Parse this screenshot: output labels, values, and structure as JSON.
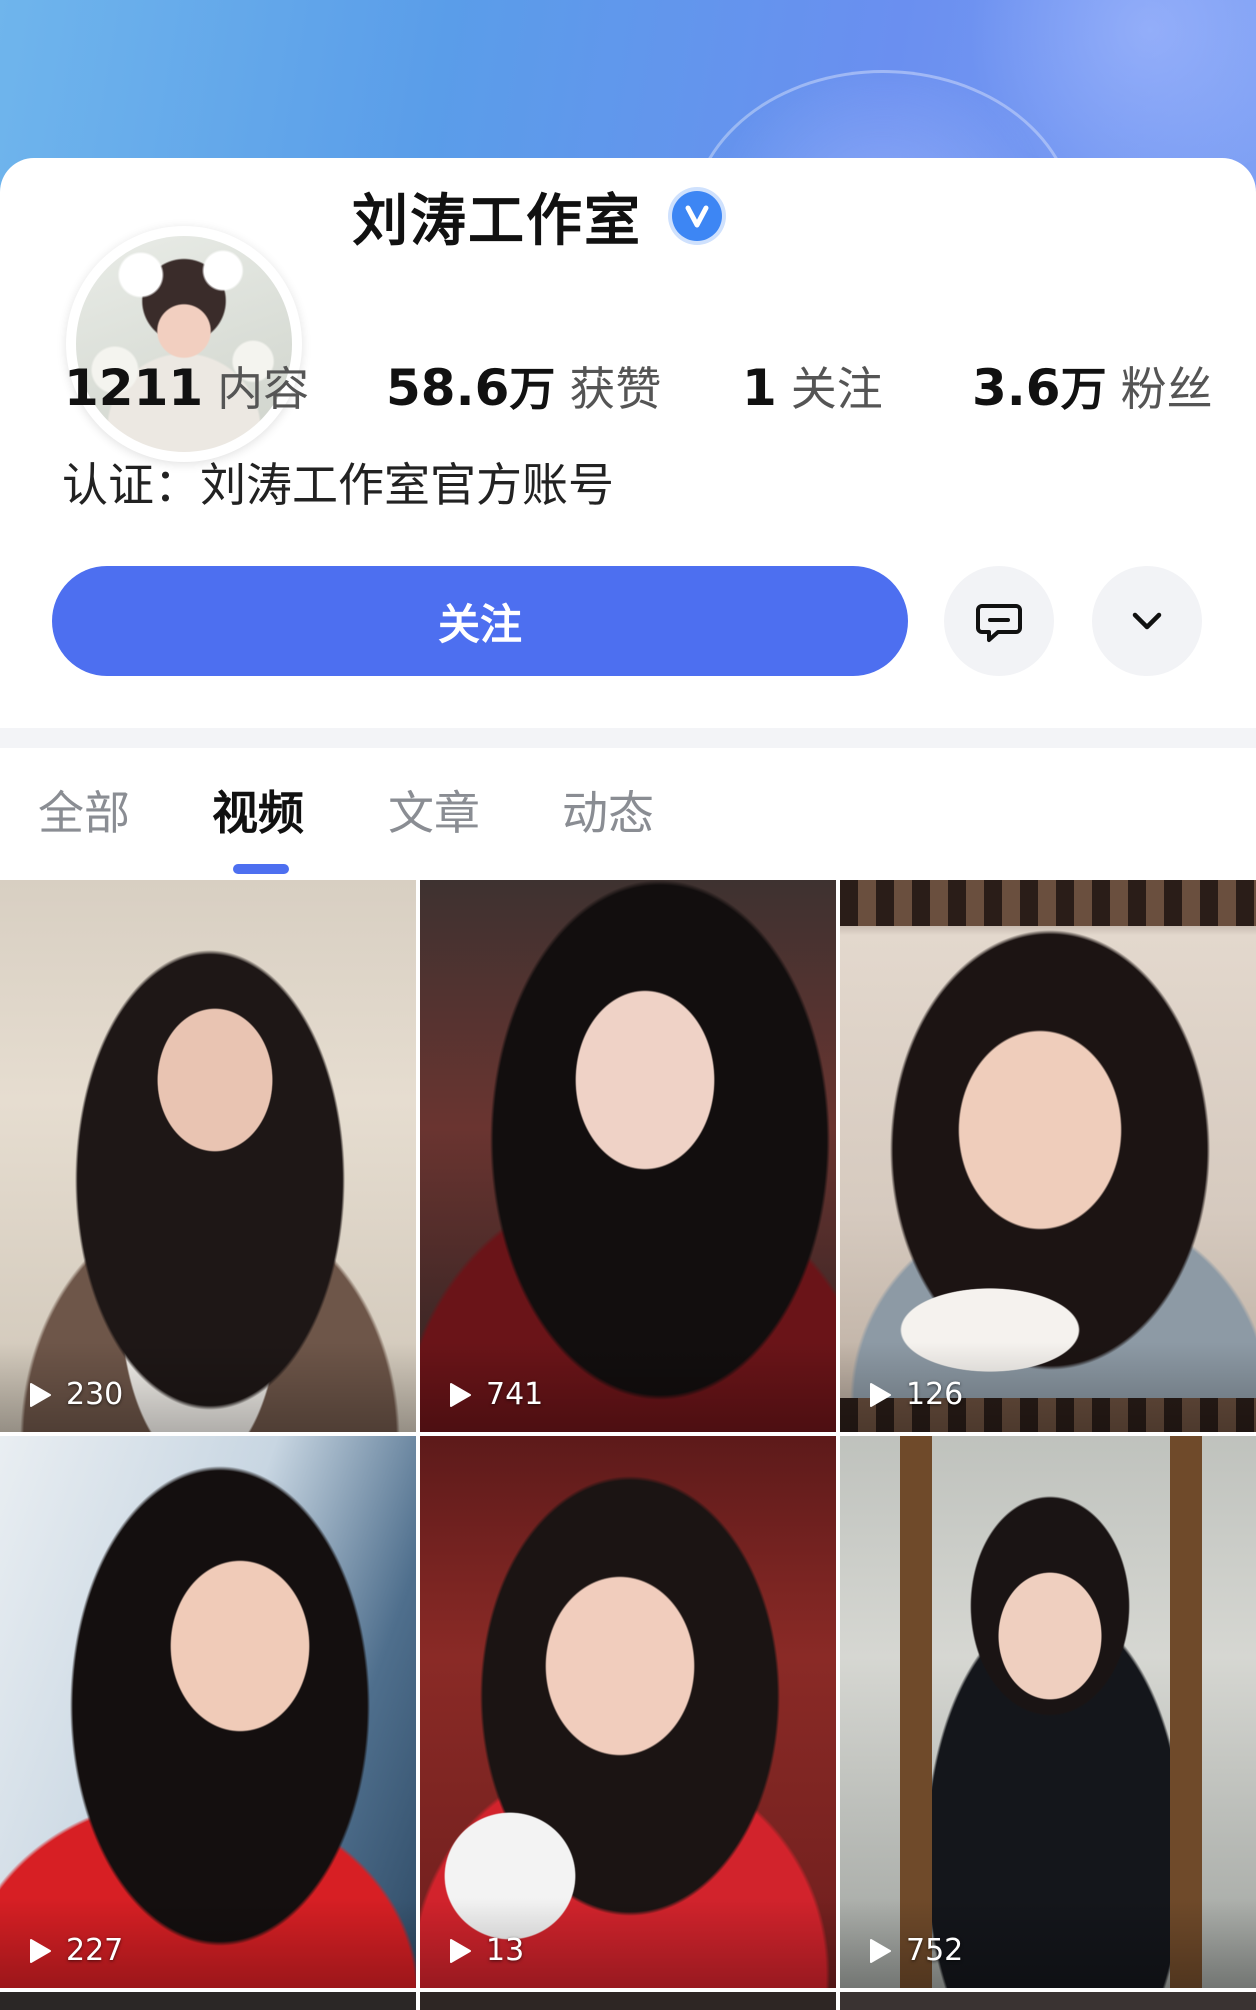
{
  "profile": {
    "name": "刘涛工作室",
    "verified_icon": "verified-v-icon",
    "stats": [
      {
        "value": "1211",
        "unit": "",
        "label": "内容"
      },
      {
        "value": "58.6",
        "unit": "万",
        "label": "获赞"
      },
      {
        "value": "1",
        "unit": "",
        "label": "关注"
      },
      {
        "value": "3.6",
        "unit": "万",
        "label": "粉丝"
      }
    ],
    "certification": "认证：刘涛工作室官方账号"
  },
  "actions": {
    "follow_label": "关注",
    "message_icon": "message-icon",
    "more_icon": "chevron-down-icon"
  },
  "tabs": [
    {
      "label": "全部",
      "active": false
    },
    {
      "label": "视频",
      "active": true
    },
    {
      "label": "文章",
      "active": false
    },
    {
      "label": "动态",
      "active": false
    }
  ],
  "videos": [
    {
      "play_count": "230"
    },
    {
      "play_count": "741"
    },
    {
      "play_count": "126"
    },
    {
      "play_count": "227"
    },
    {
      "play_count": "13"
    },
    {
      "play_count": "752"
    }
  ],
  "colors": {
    "accent": "#4d6ff0",
    "verified": "#3d86f4",
    "inactive_tab": "#8a8d93"
  }
}
